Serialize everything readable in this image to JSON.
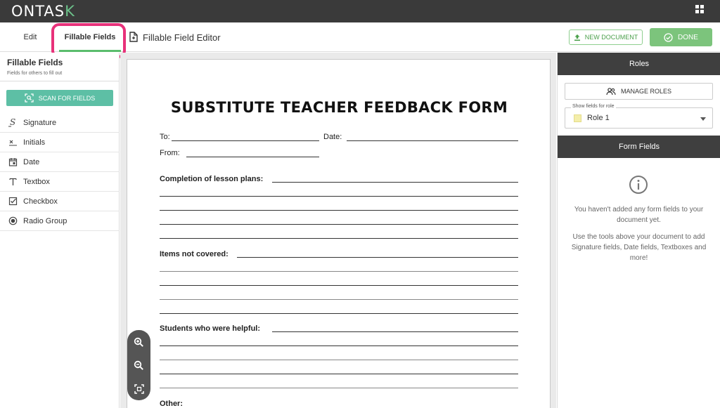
{
  "app": {
    "logo_main": "ONTAS",
    "logo_accent": "K"
  },
  "toolbar": {
    "tab_edit": "Edit",
    "tab_fillable": "Fillable Fields",
    "editor_title": "Fillable Field Editor",
    "new_document": "NEW DOCUMENT",
    "done": "DONE"
  },
  "sidebar": {
    "title": "Fillable Fields",
    "subtitle": "Fields for others to fill out",
    "scan_button": "SCAN FOR FIELDS",
    "items": [
      {
        "label": "Signature",
        "icon": "signature-icon"
      },
      {
        "label": "Initials",
        "icon": "initials-icon"
      },
      {
        "label": "Date",
        "icon": "calendar-icon"
      },
      {
        "label": "Textbox",
        "icon": "textbox-icon"
      },
      {
        "label": "Checkbox",
        "icon": "checkbox-icon"
      },
      {
        "label": "Radio Group",
        "icon": "radio-icon"
      }
    ]
  },
  "document": {
    "title": "SUBSTITUTE TEACHER FEEDBACK FORM",
    "to_label": "To:",
    "date_label": "Date:",
    "from_label": "From:",
    "section1": "Completion of lesson plans:",
    "section2": "Items not covered:",
    "section3": "Students who were helpful:",
    "section4": "Other:"
  },
  "right_panel": {
    "roles_header": "Roles",
    "manage_roles": "MANAGE ROLES",
    "show_fields_label": "Show fields for role",
    "role_value": "Role 1",
    "role_color": "#f4eeaa",
    "form_fields_header": "Form Fields",
    "empty_line1": "You haven't added any form fields to your document yet.",
    "empty_line2": "Use the tools above your document to add Signature fields, Date fields, Textboxes and more!"
  },
  "colors": {
    "accent_green": "#5bbd6d",
    "scan_teal": "#5dbfa5",
    "highlight_pink": "#e8317a"
  }
}
